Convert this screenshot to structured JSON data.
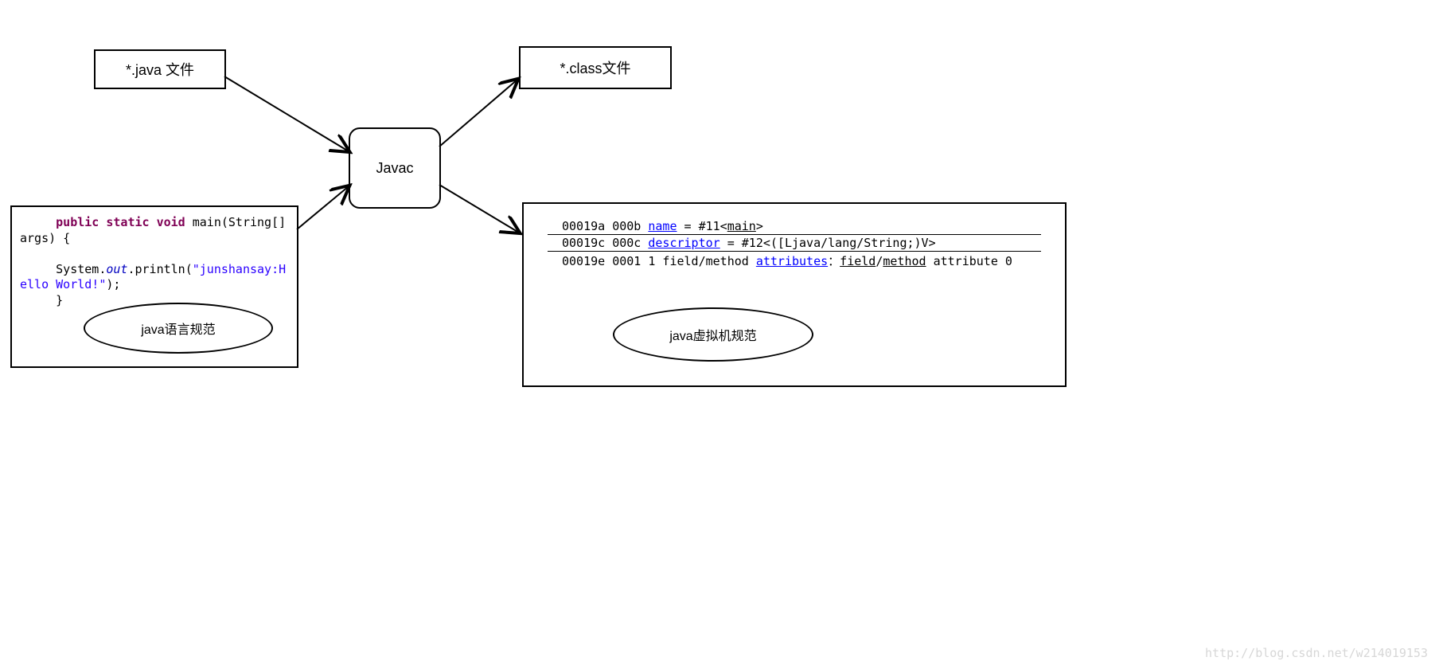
{
  "boxes": {
    "java_file": "*.java 文件",
    "class_file": "*.class文件",
    "javac": "Javac"
  },
  "ellipses": {
    "left": "java语言规范",
    "right": "java虚拟机规范"
  },
  "source_code": {
    "kw1": "public static void",
    "sig": " main(String[] args) {",
    "obj": "System.",
    "out": "out",
    "call": ".println(",
    "str": "\"junshansay:Hello World!\"",
    "end": ");",
    "close": "}"
  },
  "bytecode": {
    "r1": {
      "addr": "00019a 000b ",
      "key": "name",
      "rest": " = #11<",
      "main": "main",
      "tail": ">"
    },
    "r2": {
      "addr": "00019c 000c ",
      "key": "descriptor",
      "rest": " = #12<([Ljava/lang/String;)V>"
    },
    "r3": {
      "addr": "00019e 0001 1 field/method ",
      "key": "attributes",
      "colon": "：",
      "m1": "field",
      "slash": "/",
      "m2": "method",
      "tail": " attribute 0"
    }
  },
  "watermark": "http://blog.csdn.net/w214019153"
}
